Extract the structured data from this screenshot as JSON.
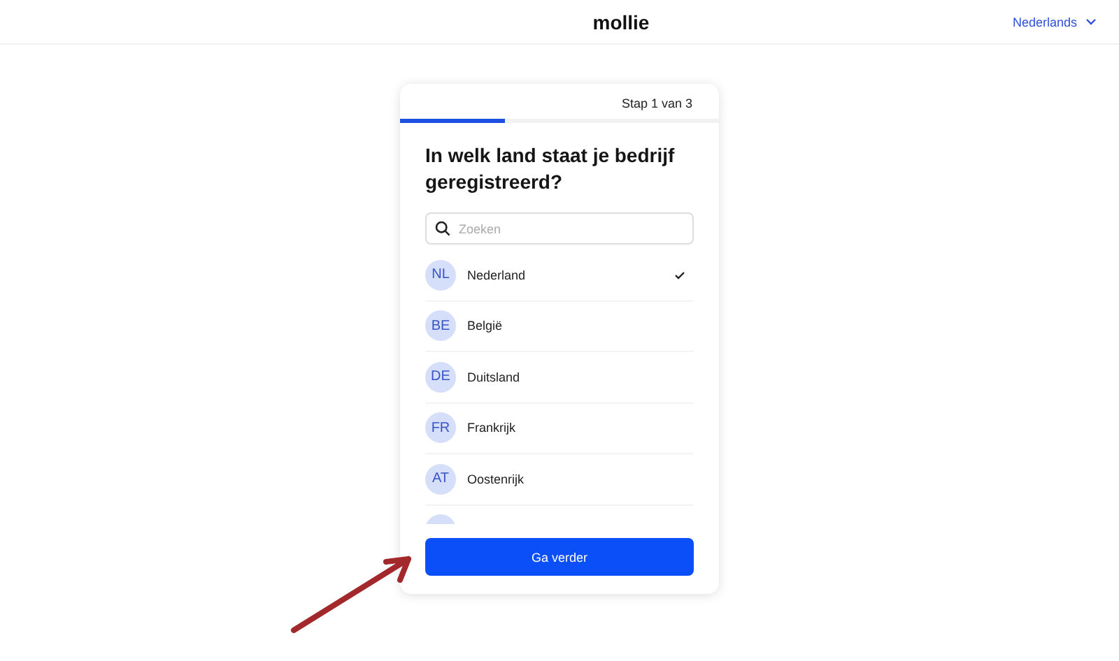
{
  "header": {
    "logo": "mollie",
    "language": "Nederlands"
  },
  "card": {
    "step": "Stap 1 van 3",
    "progress": {
      "level": 0.33
    },
    "title": "In welk land staat je bedrijf geregistreerd?",
    "search": {
      "placeholder": "Zoeken"
    },
    "countries": [
      {
        "code": "NL",
        "name": "Nederland",
        "selected": true
      },
      {
        "code": "BE",
        "name": "België",
        "selected": false
      },
      {
        "code": "DE",
        "name": "Duitsland",
        "selected": false
      },
      {
        "code": "FR",
        "name": "Frankrijk",
        "selected": false
      },
      {
        "code": "AT",
        "name": "Oostenrijk",
        "selected": false
      }
    ],
    "button": "Ga verder"
  }
}
